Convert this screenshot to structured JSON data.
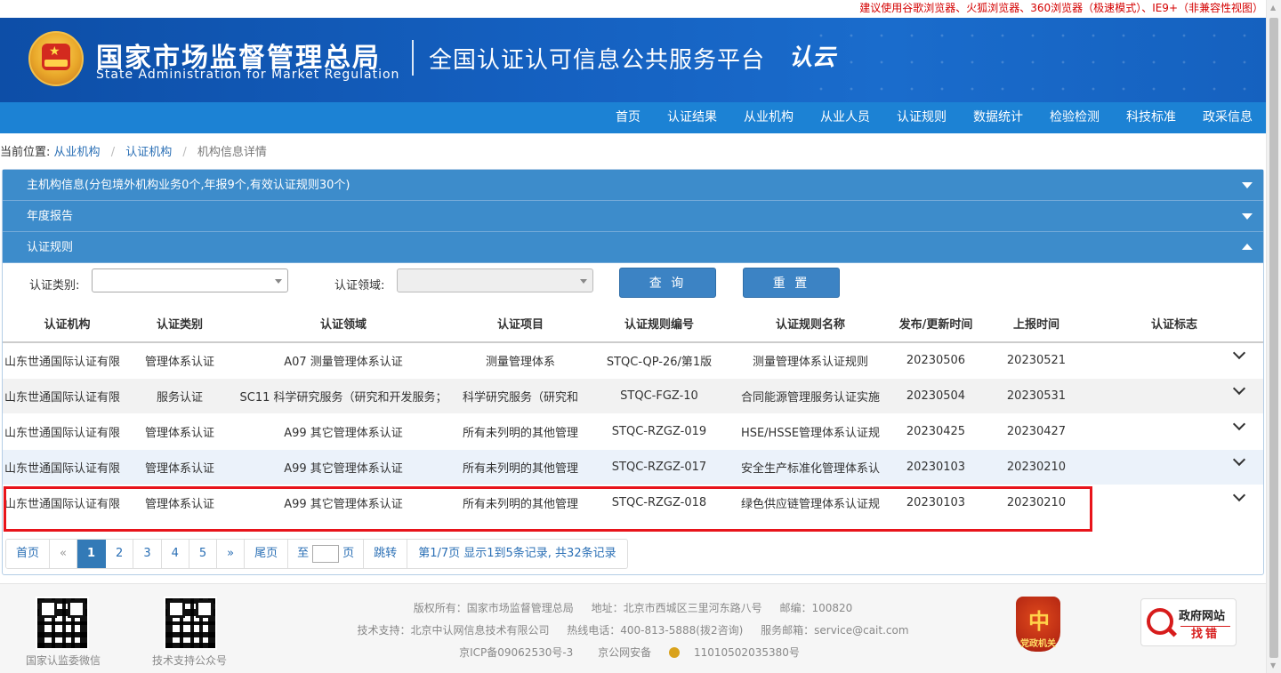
{
  "top_notice": "建议使用谷歌浏览器、火狐浏览器、360浏览器（极速模式）、IE9+（非兼容性视图）",
  "header": {
    "org_name_cn": "国家市场监督管理总局",
    "org_name_en": "State Administration  for  Market Regulation",
    "platform_name": "全国认证认可信息公共服务平台",
    "logo_text": "认云"
  },
  "nav": {
    "items": [
      "首页",
      "认证结果",
      "从业机构",
      "从业人员",
      "认证规则",
      "数据统计",
      "检验检测",
      "科技标准",
      "政采信息"
    ]
  },
  "breadcrumb": {
    "prefix": "当前位置:",
    "items": [
      "从业机构",
      "认证机构",
      "机构信息详情"
    ]
  },
  "accordion": {
    "main_info": "主机构信息(分包境外机构业务0个,年报9个,有效认证规则30个)",
    "annual_report": "年度报告",
    "rules": "认证规则"
  },
  "filter": {
    "category_label": "认证类别:",
    "category_value": "",
    "domain_label": "认证领域:",
    "domain_value": "",
    "query_button": "查 询",
    "reset_button": "重 置"
  },
  "table": {
    "headers": [
      "认证机构",
      "认证类别",
      "认证领域",
      "认证项目",
      "认证规则编号",
      "认证规则名称",
      "发布/更新时间",
      "上报时间",
      "认证标志"
    ],
    "rows": [
      [
        "山东世通国际认证有限",
        "管理体系认证",
        "A07 测量管理体系认证",
        "测量管理体系",
        "STQC-QP-26/第1版",
        "测量管理体系认证规则",
        "20230506",
        "20230521",
        ""
      ],
      [
        "山东世通国际认证有限",
        "服务认证",
        "SC11 科学研究服务（研究和开发服务；",
        "科学研究服务（研究和",
        "STQC-FGZ-10",
        "合同能源管理服务认证实施",
        "20230504",
        "20230531",
        ""
      ],
      [
        "山东世通国际认证有限",
        "管理体系认证",
        "A99 其它管理体系认证",
        "所有未列明的其他管理",
        "STQC-RZGZ-019",
        "HSE/HSSE管理体系认证规",
        "20230425",
        "20230427",
        ""
      ],
      [
        "山东世通国际认证有限",
        "管理体系认证",
        "A99 其它管理体系认证",
        "所有未列明的其他管理",
        "STQC-RZGZ-017",
        "安全生产标准化管理体系认",
        "20230103",
        "20230210",
        ""
      ],
      [
        "山东世通国际认证有限",
        "管理体系认证",
        "A99 其它管理体系认证",
        "所有未列明的其他管理",
        "STQC-RZGZ-018",
        "绿色供应链管理体系认证规",
        "20230103",
        "20230210",
        ""
      ]
    ]
  },
  "pager": {
    "first": "首页",
    "prev": "«",
    "pages": [
      "1",
      "2",
      "3",
      "4",
      "5"
    ],
    "active_page": "1",
    "next": "»",
    "last": "尾页",
    "goto_prefix": "至",
    "goto_suffix": "页",
    "jump": "跳转",
    "info": "第1/7页  显示1到5条记录, 共32条记录"
  },
  "footer": {
    "qr1_label": "国家认监委微信",
    "qr2_label": "技术支持公众号",
    "line1": [
      "版权所有：国家市场监督管理总局",
      "地址：北京市西城区三里河东路八号",
      "邮编：100820"
    ],
    "line2": [
      "技术支持：北京中认网信息技术有限公司",
      "热线电话：400-813-5888(拨2咨询)",
      "服务邮箱：service@cait.com"
    ],
    "icp": "京ICP备09062530号-3",
    "police_prefix": "京公网安备",
    "police_no": "11010502035380号",
    "badge_text": "党政机关",
    "gov_title": "政府网站",
    "gov_sub": "找错"
  },
  "colors": {
    "banner": "#1561c1",
    "nav": "#1c82d4",
    "accordion": "#3d8ccb",
    "highlight": "#e8141b"
  }
}
